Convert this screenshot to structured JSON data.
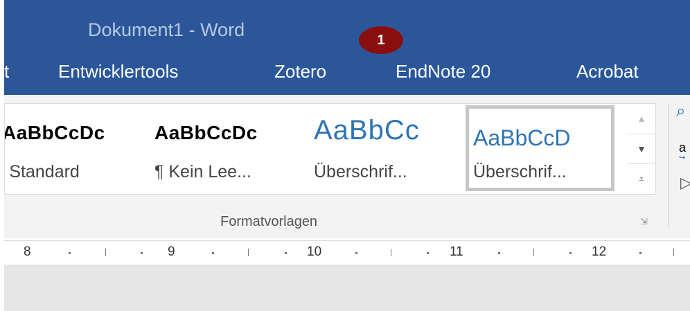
{
  "window": {
    "title": "Dokument1 - Word",
    "badge": "1"
  },
  "tabs": [
    "t",
    "Entwicklertools",
    "Zotero",
    "EndNote 20",
    "Acrobat"
  ],
  "styles": [
    {
      "sample": "AaBbCcDc",
      "name": "¶ Standard",
      "color": "#000000"
    },
    {
      "sample": "AaBbCcDc",
      "name": "¶ Kein Lee...",
      "color": "#000000"
    },
    {
      "sample": "AaBbCc",
      "name": "Überschrif...",
      "color": "#2e74b5"
    },
    {
      "sample": "AaBbCcD",
      "name": "Überschrif...",
      "color": "#2e74b5"
    }
  ],
  "group": {
    "label": "Formatvorlagen"
  },
  "ruler": {
    "numbers": [
      "8",
      "9",
      "10",
      "11",
      "12"
    ]
  },
  "colors": {
    "titlebar": "#2b579a",
    "badge": "#8b0e0e",
    "heading": "#2e74b5"
  }
}
